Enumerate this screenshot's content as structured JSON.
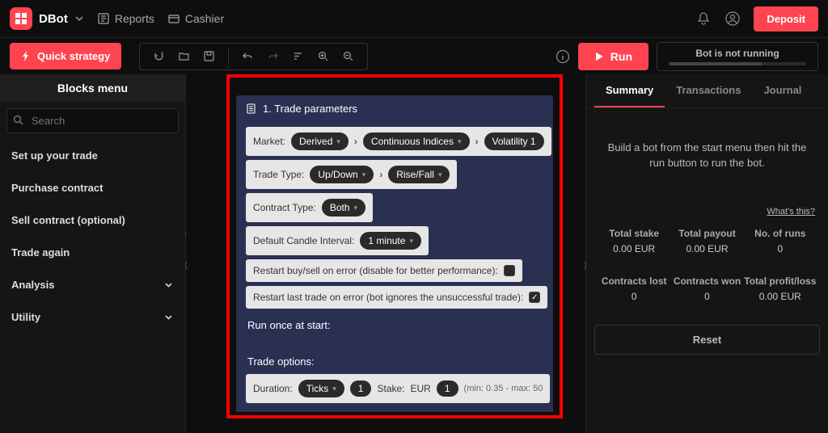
{
  "topbar": {
    "brand": "DBot",
    "reports": "Reports",
    "cashier": "Cashier",
    "deposit": "Deposit"
  },
  "toolbar": {
    "quick_strategy": "Quick strategy"
  },
  "run": {
    "label": "Run"
  },
  "status": {
    "text": "Bot is not running"
  },
  "sidebar": {
    "title": "Blocks menu",
    "search_placeholder": "Search",
    "items": [
      {
        "label": "Set up your trade",
        "expandable": false
      },
      {
        "label": "Purchase contract",
        "expandable": false
      },
      {
        "label": "Sell contract (optional)",
        "expandable": false
      },
      {
        "label": "Trade again",
        "expandable": false
      },
      {
        "label": "Analysis",
        "expandable": true
      },
      {
        "label": "Utility",
        "expandable": true
      }
    ]
  },
  "block": {
    "title": "1. Trade parameters",
    "market_label": "Market:",
    "market_1": "Derived",
    "market_2": "Continuous Indices",
    "market_3": "Volatility 1",
    "trade_type_label": "Trade Type:",
    "trade_type_1": "Up/Down",
    "trade_type_2": "Rise/Fall",
    "contract_type_label": "Contract Type:",
    "contract_type": "Both",
    "candle_label": "Default Candle Interval:",
    "candle_value": "1 minute",
    "restart_buysell": "Restart buy/sell on error (disable for better performance):",
    "restart_last": "Restart last trade on error (bot ignores the unsuccessful trade):",
    "run_once": "Run once at start:",
    "trade_options": "Trade options:",
    "duration_label": "Duration:",
    "duration_unit": "Ticks",
    "duration_value": "1",
    "stake_label": "Stake:",
    "stake_currency": "EUR",
    "stake_value": "1",
    "stake_hint": "(min: 0.35 - max: 50"
  },
  "tabs": {
    "summary": "Summary",
    "transactions": "Transactions",
    "journal": "Journal"
  },
  "summary": {
    "hint": "Build a bot from the start menu then hit the run button to run the bot.",
    "whats_this": "What's this?",
    "stats_row1": [
      {
        "label": "Total stake",
        "value": "0.00 EUR"
      },
      {
        "label": "Total payout",
        "value": "0.00 EUR"
      },
      {
        "label": "No. of runs",
        "value": "0"
      }
    ],
    "stats_row2": [
      {
        "label": "Contracts lost",
        "value": "0"
      },
      {
        "label": "Contracts won",
        "value": "0"
      },
      {
        "label": "Total profit/loss",
        "value": "0.00 EUR"
      }
    ],
    "reset": "Reset"
  }
}
